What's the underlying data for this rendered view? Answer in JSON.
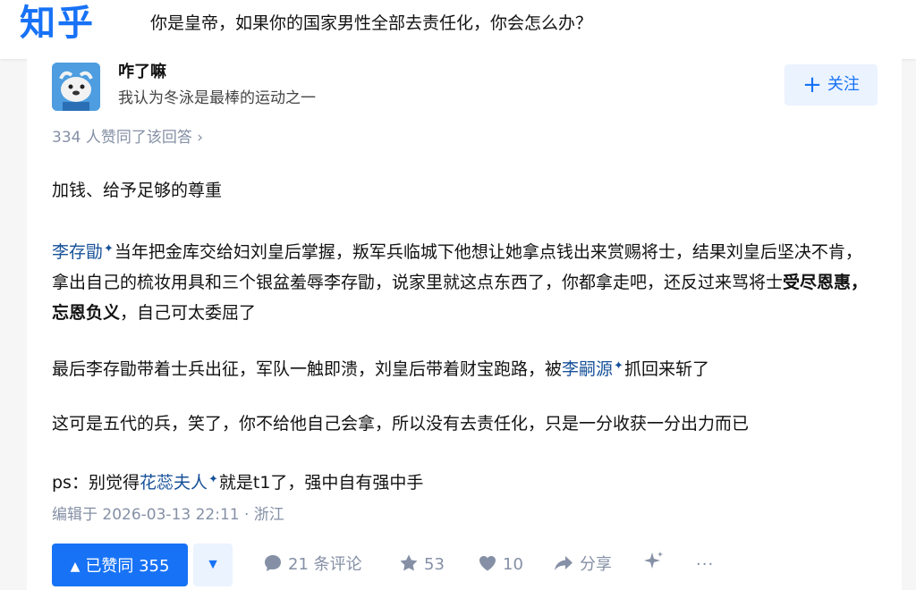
{
  "header": {
    "logo": "知乎",
    "question_title": "你是皇帝，如果你的国家男性全部去责任化，你会怎么办？"
  },
  "author": {
    "name": "咋了嘛",
    "bio": "我认为冬泳是最棒的运动之一",
    "follow_label": "关注"
  },
  "vote_summary": "334 人赞同了该回答 ›",
  "content": {
    "p1": "加钱、给予足够的尊重",
    "p2": {
      "link": "李存勖",
      "text_a": "当年把金库交给妇刘皇后掌握，叛军兵临城下他想让她拿点钱出来赏赐将士，结果刘皇后坚决不肯，拿出自己的梳妆用具和三个银盆羞辱李存勖，说家里就这点东西了，你都拿走吧，还反过来骂将士",
      "bold": "受尽恩惠，忘恩负义",
      "text_b": "，自己可太委屈了"
    },
    "p3": {
      "text_a": "最后李存勖带着士兵出征，军队一触即溃，刘皇后带着财宝跑路，被",
      "link": "李嗣源",
      "text_b": "抓回来斩了"
    },
    "p4": "这可是五代的兵，笑了，你不给他自己会拿，所以没有去责任化，只是一分收获一分出力而已",
    "p5": {
      "text_a": "ps：别觉得",
      "link": "花蕊夫人",
      "text_b": "就是t1了，强中自有强中手"
    }
  },
  "meta": "编辑于 2026-03-13 22:11 · 浙江",
  "actions": {
    "upvote_label": "已赞同 355",
    "comments": "21 条评论",
    "favorites": "53",
    "likes": "10",
    "share": "分享",
    "more": "···"
  },
  "colors": {
    "brand": "#1772f6",
    "link": "#175199",
    "muted": "#8590a6"
  }
}
